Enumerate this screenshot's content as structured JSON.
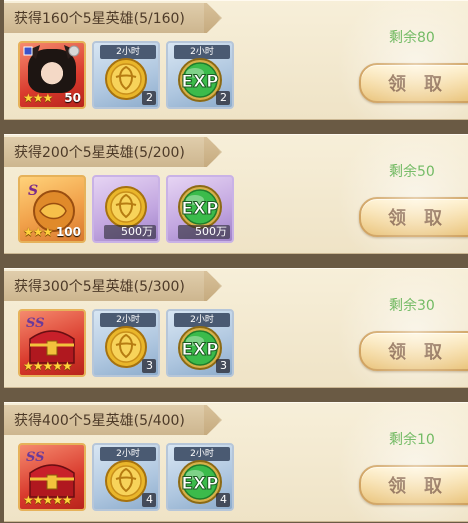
{
  "rows": [
    {
      "title": "获得160个5星英雄(5/160)",
      "remain": "剩余80",
      "button": "领取",
      "items": [
        {
          "kind": "hero",
          "icon": "hero-portrait-icon",
          "stars": "★★★",
          "level": "50"
        },
        {
          "kind": "coin",
          "icon": "gold-coin-icon",
          "tag": "2小时",
          "count": "2"
        },
        {
          "kind": "exp",
          "icon": "exp-orb-icon",
          "tag": "2小时",
          "count": "2",
          "exp_label": "EXP"
        }
      ]
    },
    {
      "title": "获得200个5星英雄(5/200)",
      "remain": "剩余50",
      "button": "领取",
      "items": [
        {
          "kind": "token",
          "icon": "s-grade-token-icon",
          "stars": "★★★",
          "level": "100"
        },
        {
          "kind": "coin",
          "icon": "gold-coin-icon",
          "count": "500万"
        },
        {
          "kind": "exp",
          "icon": "exp-orb-icon",
          "count": "500万",
          "exp_label": "EXP"
        }
      ]
    },
    {
      "title": "获得300个5星英雄(5/300)",
      "remain": "剩余30",
      "button": "领取",
      "items": [
        {
          "kind": "chest",
          "icon": "ss-chest-icon",
          "stars": "★★★★★"
        },
        {
          "kind": "coin",
          "icon": "gold-coin-icon",
          "tag": "2小时",
          "count": "3"
        },
        {
          "kind": "exp",
          "icon": "exp-orb-icon",
          "tag": "2小时",
          "count": "3",
          "exp_label": "EXP"
        }
      ]
    },
    {
      "title": "获得400个5星英雄(5/400)",
      "remain": "剩余10",
      "button": "领取",
      "items": [
        {
          "kind": "chest",
          "icon": "ss-chest-icon",
          "stars": "★★★★★"
        },
        {
          "kind": "coin",
          "icon": "gold-coin-icon",
          "tag": "2小时",
          "count": "4"
        },
        {
          "kind": "exp",
          "icon": "exp-orb-icon",
          "tag": "2小时",
          "count": "4",
          "exp_label": "EXP"
        }
      ]
    }
  ],
  "colors": {
    "remain": "#2f9a1a",
    "button_text": "#6b3f1c",
    "title_text": "#4d3a28"
  }
}
